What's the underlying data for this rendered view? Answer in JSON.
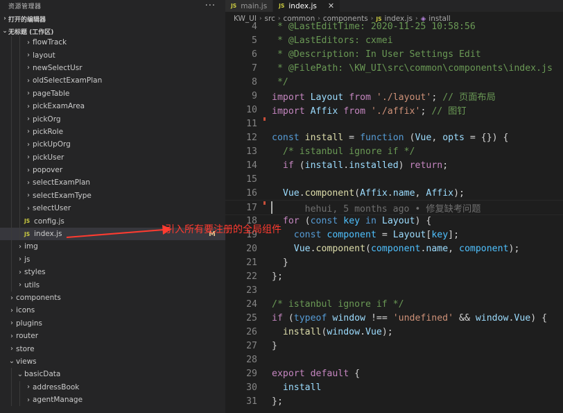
{
  "sidebar": {
    "title": "资源管理器",
    "more": "···",
    "open_editors": "打开的编辑器",
    "workspace": "无标题 (工作区)",
    "tree": [
      {
        "label": "flowTrack",
        "kind": "folder",
        "level": 3,
        "expanded": false
      },
      {
        "label": "layout",
        "kind": "folder",
        "level": 3,
        "expanded": false
      },
      {
        "label": "newSelectUsr",
        "kind": "folder",
        "level": 3,
        "expanded": false
      },
      {
        "label": "oldSelectExamPlan",
        "kind": "folder",
        "level": 3,
        "expanded": false
      },
      {
        "label": "pageTable",
        "kind": "folder",
        "level": 3,
        "expanded": false
      },
      {
        "label": "pickExamArea",
        "kind": "folder",
        "level": 3,
        "expanded": false
      },
      {
        "label": "pickOrg",
        "kind": "folder",
        "level": 3,
        "expanded": false
      },
      {
        "label": "pickRole",
        "kind": "folder",
        "level": 3,
        "expanded": false
      },
      {
        "label": "pickUpOrg",
        "kind": "folder",
        "level": 3,
        "expanded": false
      },
      {
        "label": "pickUser",
        "kind": "folder",
        "level": 3,
        "expanded": false
      },
      {
        "label": "popover",
        "kind": "folder",
        "level": 3,
        "expanded": false
      },
      {
        "label": "selectExamPlan",
        "kind": "folder",
        "level": 3,
        "expanded": false
      },
      {
        "label": "selectExamType",
        "kind": "folder",
        "level": 3,
        "expanded": false
      },
      {
        "label": "selectUser",
        "kind": "folder",
        "level": 3,
        "expanded": false
      },
      {
        "label": "config.js",
        "kind": "js",
        "level": 3
      },
      {
        "label": "index.js",
        "kind": "js",
        "level": 3,
        "selected": true,
        "badge": "M"
      },
      {
        "label": "img",
        "kind": "folder",
        "level": 2,
        "expanded": false
      },
      {
        "label": "js",
        "kind": "folder",
        "level": 2,
        "expanded": false
      },
      {
        "label": "styles",
        "kind": "folder",
        "level": 2,
        "expanded": false
      },
      {
        "label": "utils",
        "kind": "folder",
        "level": 2,
        "expanded": false
      },
      {
        "label": "components",
        "kind": "folder",
        "level": 1,
        "expanded": false
      },
      {
        "label": "icons",
        "kind": "folder",
        "level": 1,
        "expanded": false
      },
      {
        "label": "plugins",
        "kind": "folder",
        "level": 1,
        "expanded": false
      },
      {
        "label": "router",
        "kind": "folder",
        "level": 1,
        "expanded": false
      },
      {
        "label": "store",
        "kind": "folder",
        "level": 1,
        "expanded": false
      },
      {
        "label": "views",
        "kind": "folder",
        "level": 1,
        "expanded": true
      },
      {
        "label": "basicData",
        "kind": "folder",
        "level": 2,
        "expanded": true
      },
      {
        "label": "addressBook",
        "kind": "folder",
        "level": 3,
        "expanded": false
      },
      {
        "label": "agentManage",
        "kind": "folder",
        "level": 3,
        "expanded": false
      }
    ]
  },
  "tabs": [
    {
      "label": "main.js",
      "active": false
    },
    {
      "label": "index.js",
      "active": true,
      "close": "✕"
    }
  ],
  "breadcrumb": [
    "KW_UI",
    "src",
    "common",
    "components",
    "index.js",
    "install"
  ],
  "annotation": "引入所有要注册的全局组件",
  "colors": {
    "annotation": "#ff3b30",
    "js_icon": "#cbcb41",
    "modified": "#e2c08d"
  },
  "code_lines": [
    {
      "n": "4",
      "segs": [
        [
          " * @LastEditTime: 2020-11-25 10:58:56",
          "cm"
        ]
      ]
    },
    {
      "n": "5",
      "segs": [
        [
          " * @LastEditors: cxmei",
          "cm"
        ]
      ]
    },
    {
      "n": "6",
      "segs": [
        [
          " * @Description: In User Settings Edit",
          "cm"
        ]
      ]
    },
    {
      "n": "7",
      "segs": [
        [
          " * @FilePath: \\KW_UI\\src\\common\\components\\index.js",
          "cm"
        ]
      ]
    },
    {
      "n": "8",
      "segs": [
        [
          " */",
          "cm"
        ]
      ]
    },
    {
      "n": "9",
      "segs": [
        [
          "import",
          "ctl"
        ],
        [
          " ",
          "pn"
        ],
        [
          "Layout",
          "var"
        ],
        [
          " ",
          "pn"
        ],
        [
          "from",
          "ctl"
        ],
        [
          " ",
          "pn"
        ],
        [
          "'./layout'",
          "str"
        ],
        [
          "; ",
          "pn"
        ],
        [
          "// 页面布局",
          "cm"
        ]
      ]
    },
    {
      "n": "10",
      "segs": [
        [
          "import",
          "ctl"
        ],
        [
          " ",
          "pn"
        ],
        [
          "Affix",
          "var"
        ],
        [
          " ",
          "pn"
        ],
        [
          "from",
          "ctl"
        ],
        [
          " ",
          "pn"
        ],
        [
          "'./affix'",
          "str"
        ],
        [
          "; ",
          "pn"
        ],
        [
          "// 图钉",
          "cm"
        ]
      ]
    },
    {
      "n": "11",
      "segs": []
    },
    {
      "n": "12",
      "segs": [
        [
          "const",
          "kw"
        ],
        [
          " ",
          "pn"
        ],
        [
          "install",
          "fn"
        ],
        [
          " = ",
          "pn"
        ],
        [
          "function",
          "kw"
        ],
        [
          " (",
          "pn"
        ],
        [
          "Vue",
          "var"
        ],
        [
          ", ",
          "pn"
        ],
        [
          "opts",
          "var"
        ],
        [
          " = {}) ",
          "pn"
        ],
        [
          "{",
          "pn"
        ]
      ]
    },
    {
      "n": "13",
      "segs": [
        [
          "  /* istanbul ignore if */",
          "cm"
        ]
      ]
    },
    {
      "n": "14",
      "segs": [
        [
          "  ",
          "pn"
        ],
        [
          "if",
          "ctl"
        ],
        [
          " (",
          "pn"
        ],
        [
          "install",
          "var"
        ],
        [
          ".",
          "pn"
        ],
        [
          "installed",
          "var"
        ],
        [
          ") ",
          "pn"
        ],
        [
          "return",
          "ctl"
        ],
        [
          ";",
          "pn"
        ]
      ]
    },
    {
      "n": "15",
      "segs": []
    },
    {
      "n": "16",
      "segs": [
        [
          "  ",
          "pn"
        ],
        [
          "Vue",
          "var"
        ],
        [
          ".",
          "pn"
        ],
        [
          "component",
          "fn"
        ],
        [
          "(",
          "pn"
        ],
        [
          "Affix",
          "var"
        ],
        [
          ".",
          "pn"
        ],
        [
          "name",
          "var"
        ],
        [
          ", ",
          "pn"
        ],
        [
          "Affix",
          "var"
        ],
        [
          ");",
          "pn"
        ]
      ]
    },
    {
      "n": "17",
      "segs": [
        [
          "      hehui, 5 months ago • 修复缺考问题",
          "blame"
        ]
      ]
    },
    {
      "n": "18",
      "segs": [
        [
          "  ",
          "pn"
        ],
        [
          "for",
          "ctl"
        ],
        [
          " (",
          "pn"
        ],
        [
          "const",
          "kw"
        ],
        [
          " ",
          "pn"
        ],
        [
          "key",
          "const"
        ],
        [
          " ",
          "pn"
        ],
        [
          "in",
          "kw"
        ],
        [
          " ",
          "pn"
        ],
        [
          "Layout",
          "var"
        ],
        [
          ") {",
          "pn"
        ]
      ]
    },
    {
      "n": "19",
      "segs": [
        [
          "    ",
          "pn"
        ],
        [
          "const",
          "kw"
        ],
        [
          " ",
          "pn"
        ],
        [
          "component",
          "const"
        ],
        [
          " = ",
          "pn"
        ],
        [
          "Layout",
          "var"
        ],
        [
          "[",
          "pn"
        ],
        [
          "key",
          "const"
        ],
        [
          "];",
          "pn"
        ]
      ]
    },
    {
      "n": "20",
      "segs": [
        [
          "    ",
          "pn"
        ],
        [
          "Vue",
          "var"
        ],
        [
          ".",
          "pn"
        ],
        [
          "component",
          "fn"
        ],
        [
          "(",
          "pn"
        ],
        [
          "component",
          "const"
        ],
        [
          ".",
          "pn"
        ],
        [
          "name",
          "var"
        ],
        [
          ", ",
          "pn"
        ],
        [
          "component",
          "const"
        ],
        [
          ");",
          "pn"
        ]
      ]
    },
    {
      "n": "21",
      "segs": [
        [
          "  }",
          "pn"
        ]
      ]
    },
    {
      "n": "22",
      "segs": [
        [
          "};",
          "pn"
        ]
      ]
    },
    {
      "n": "23",
      "segs": []
    },
    {
      "n": "24",
      "segs": [
        [
          "/* istanbul ignore if */",
          "cm"
        ]
      ]
    },
    {
      "n": "25",
      "segs": [
        [
          "if",
          "ctl"
        ],
        [
          " (",
          "pn"
        ],
        [
          "typeof",
          "kw"
        ],
        [
          " ",
          "pn"
        ],
        [
          "window",
          "var"
        ],
        [
          " !== ",
          "pn"
        ],
        [
          "'undefined'",
          "str"
        ],
        [
          " && ",
          "pn"
        ],
        [
          "window",
          "var"
        ],
        [
          ".",
          "pn"
        ],
        [
          "Vue",
          "var"
        ],
        [
          ") {",
          "pn"
        ]
      ]
    },
    {
      "n": "26",
      "segs": [
        [
          "  ",
          "pn"
        ],
        [
          "install",
          "fn"
        ],
        [
          "(",
          "pn"
        ],
        [
          "window",
          "var"
        ],
        [
          ".",
          "pn"
        ],
        [
          "Vue",
          "var"
        ],
        [
          ");",
          "pn"
        ]
      ]
    },
    {
      "n": "27",
      "segs": [
        [
          "}",
          "pn"
        ]
      ]
    },
    {
      "n": "28",
      "segs": []
    },
    {
      "n": "29",
      "segs": [
        [
          "export",
          "ctl"
        ],
        [
          " ",
          "pn"
        ],
        [
          "default",
          "ctl"
        ],
        [
          " {",
          "pn"
        ]
      ]
    },
    {
      "n": "30",
      "segs": [
        [
          "  ",
          "pn"
        ],
        [
          "install",
          "var"
        ]
      ]
    },
    {
      "n": "31",
      "segs": [
        [
          "};",
          "pn"
        ]
      ]
    }
  ]
}
